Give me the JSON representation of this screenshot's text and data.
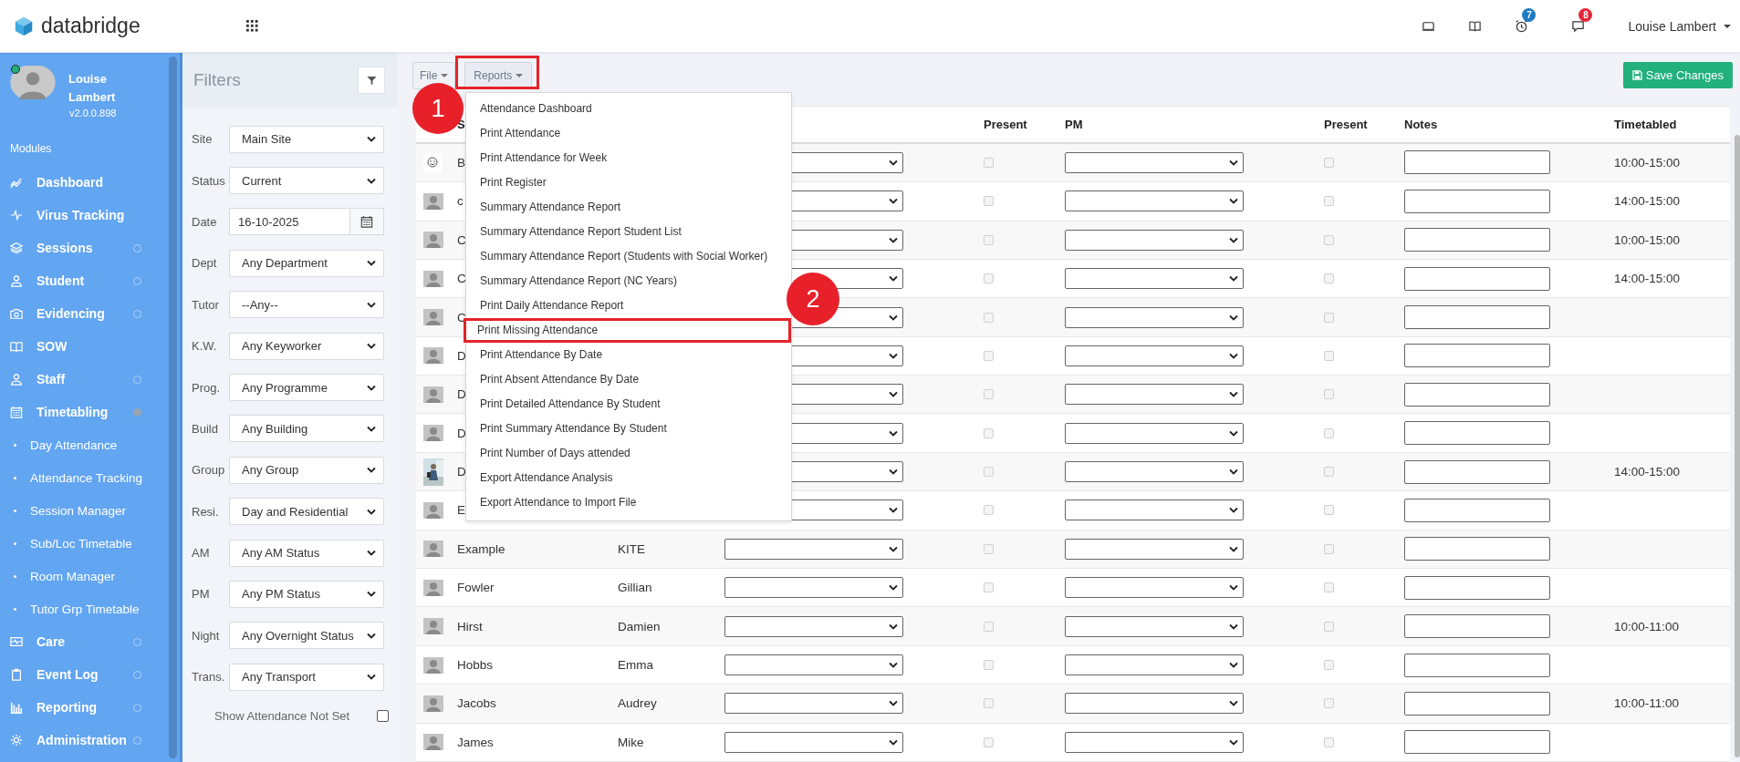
{
  "app": {
    "name": "databridge"
  },
  "topbar": {
    "alerts": [
      {
        "badge": "7",
        "color": "#1f7ac4"
      },
      {
        "badge": "8",
        "color": "#e5283a"
      }
    ],
    "user": "Louise Lambert"
  },
  "sidebar": {
    "user": {
      "name": "Louise Lambert",
      "version": "v2.0.0.898",
      "online": true
    },
    "section": "Modules",
    "items": [
      {
        "label": "Dashboard"
      },
      {
        "label": "Virus Tracking"
      },
      {
        "label": "Sessions",
        "has_submenu": true,
        "expanded": false
      },
      {
        "label": "Student",
        "has_submenu": true,
        "expanded": false
      },
      {
        "label": "Evidencing",
        "has_submenu": true,
        "expanded": false
      },
      {
        "label": "SOW"
      },
      {
        "label": "Staff",
        "has_submenu": true,
        "expanded": false
      },
      {
        "label": "Timetabling",
        "has_submenu": true,
        "expanded": true,
        "children": [
          {
            "label": "Day Attendance"
          },
          {
            "label": "Attendance Tracking"
          },
          {
            "label": "Session Manager"
          },
          {
            "label": "Sub/Loc Timetable"
          },
          {
            "label": "Room Manager"
          },
          {
            "label": "Tutor Grp Timetable"
          }
        ]
      },
      {
        "label": "Care",
        "has_submenu": true,
        "expanded": false
      },
      {
        "label": "Event Log",
        "has_submenu": true,
        "expanded": false
      },
      {
        "label": "Reporting",
        "has_submenu": true,
        "expanded": false
      },
      {
        "label": "Administration",
        "has_submenu": true,
        "expanded": false
      }
    ]
  },
  "filters": {
    "title": "Filters",
    "fields": [
      {
        "label": "Site",
        "kind": "select",
        "value": "Main Site"
      },
      {
        "label": "Status",
        "kind": "select",
        "value": "Current"
      },
      {
        "label": "Date",
        "kind": "date",
        "value": "16-10-2025"
      },
      {
        "label": "Dept",
        "kind": "select",
        "value": "Any Department"
      },
      {
        "label": "Tutor",
        "kind": "select",
        "value": "--Any--"
      },
      {
        "label": "K.W.",
        "kind": "select",
        "value": "Any Keyworker"
      },
      {
        "label": "Prog.",
        "kind": "select",
        "value": "Any Programme"
      },
      {
        "label": "Build",
        "kind": "select",
        "value": "Any Building"
      },
      {
        "label": "Group",
        "kind": "select",
        "value": "Any Group"
      },
      {
        "label": "Resi.",
        "kind": "select",
        "value": "Day and Residential"
      },
      {
        "label": "AM",
        "kind": "select",
        "value": "Any AM Status"
      },
      {
        "label": "PM",
        "kind": "select",
        "value": "Any PM Status"
      },
      {
        "label": "Night",
        "kind": "select",
        "value": "Any Overnight Status"
      },
      {
        "label": "Trans.",
        "kind": "select",
        "value": "Any Transport"
      }
    ],
    "show_not_set": {
      "label": "Show Attendance Not Set",
      "checked": false
    }
  },
  "toolbar": {
    "file": "File",
    "reports": {
      "label": "Reports",
      "highlighted": true
    },
    "save": "Save Changes"
  },
  "menu": {
    "items": [
      {
        "label": "Attendance Dashboard",
        "highlighted": false
      },
      {
        "label": "Print Attendance",
        "highlighted": false
      },
      {
        "label": "Print Attendance for Week",
        "highlighted": false
      },
      {
        "label": "Print Register",
        "highlighted": false
      },
      {
        "label": "Summary Attendance Report",
        "highlighted": false
      },
      {
        "label": "Summary Attendance Report Student List",
        "highlighted": false
      },
      {
        "label": "Summary Attendance Report (Students with Social Worker)",
        "highlighted": false
      },
      {
        "label": "Summary Attendance Report (NC Years)",
        "highlighted": false
      },
      {
        "label": "Print Daily Attendance Report",
        "highlighted": false
      },
      {
        "label": "Print Missing Attendance",
        "highlighted": true
      },
      {
        "label": "Print Attendance By Date",
        "highlighted": false
      },
      {
        "label": "Print Absent Attendance By Date",
        "highlighted": false
      },
      {
        "label": "Print Detailed Attendance By Student",
        "highlighted": false
      },
      {
        "label": "Print Summary Attendance By Student",
        "highlighted": false
      },
      {
        "label": "Print Number of Days attended",
        "highlighted": false
      },
      {
        "label": "Export Attendance Analysis",
        "highlighted": false
      },
      {
        "label": "Export Attendance to Import File",
        "highlighted": false
      }
    ]
  },
  "annotations": [
    {
      "number": "1"
    },
    {
      "number": "2"
    }
  ],
  "table": {
    "columns": {
      "surname": "S",
      "am_present": "Present",
      "pm": "PM",
      "pm_present": "Present",
      "notes": "Notes",
      "timetabled": "Timetabled"
    },
    "rows": [
      {
        "kind": "smiley",
        "surname": "B",
        "am_present": false,
        "pm_present": false,
        "timetabled": "10:00-15:00"
      },
      {
        "kind": "person",
        "surname": "c",
        "am_present": false,
        "pm_present": false,
        "timetabled": "14:00-15:00"
      },
      {
        "kind": "person",
        "surname": "C",
        "am_present": false,
        "pm_present": false,
        "timetabled": "10:00-15:00"
      },
      {
        "kind": "person",
        "surname": "C",
        "am_present": false,
        "pm_present": false,
        "timetabled": "14:00-15:00"
      },
      {
        "kind": "person",
        "surname": "C",
        "am_present": false,
        "pm_present": false
      },
      {
        "kind": "person",
        "surname": "D",
        "am_present": false,
        "pm_present": false
      },
      {
        "kind": "person",
        "surname": "D",
        "am_present": false,
        "pm_present": false
      },
      {
        "kind": "person",
        "surname": "D",
        "am_present": false,
        "pm_present": false
      },
      {
        "kind": "picture",
        "surname": "D",
        "am_present": false,
        "pm_present": false,
        "timetabled": "14:00-15:00"
      },
      {
        "kind": "person",
        "surname": "E",
        "am_present": false,
        "pm_present": false
      },
      {
        "kind": "person",
        "surname": "Example",
        "forename": "KITE",
        "am_present": false,
        "pm_present": false
      },
      {
        "kind": "person",
        "surname": "Fowler",
        "forename": "Gillian",
        "am_present": false,
        "pm_present": false
      },
      {
        "kind": "person",
        "surname": "Hirst",
        "forename": "Damien",
        "am_present": false,
        "pm_present": false,
        "timetabled": "10:00-11:00"
      },
      {
        "kind": "person",
        "surname": "Hobbs",
        "forename": "Emma",
        "am_present": false,
        "pm_present": false
      },
      {
        "kind": "person",
        "surname": "Jacobs",
        "forename": "Audrey",
        "am_present": false,
        "pm_present": false,
        "timetabled": "10:00-11:00"
      },
      {
        "kind": "person",
        "surname": "James",
        "forename": "Mike",
        "am_present": false,
        "pm_present": false
      }
    ]
  }
}
